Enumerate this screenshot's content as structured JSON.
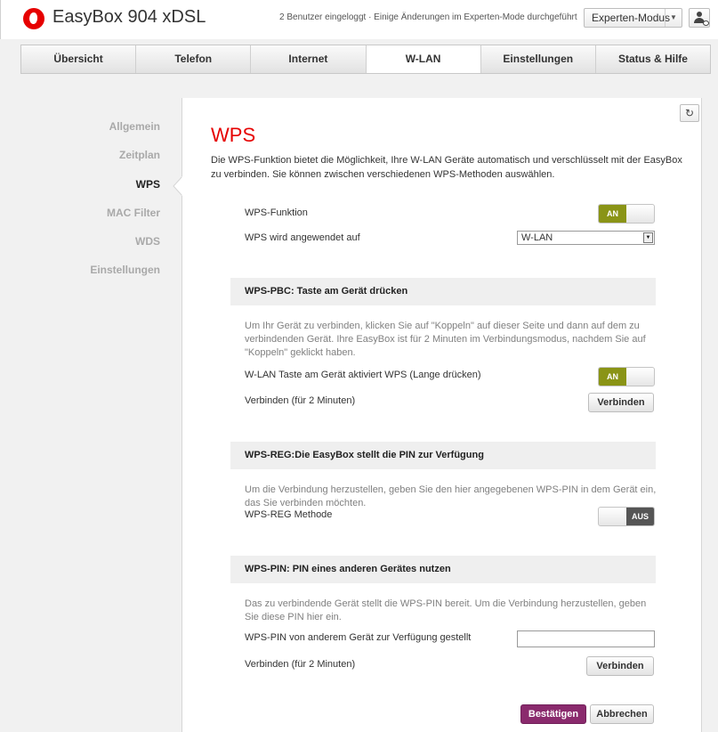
{
  "header": {
    "title": "EasyBox 904 xDSL",
    "session_info": "2 Benutzer eingeloggt · Einige Änderungen im Experten-Mode durchgeführt",
    "mode_select_value": "Experten-Modus",
    "logo_icon": "vodafone-logo",
    "user_icon": "user-icon"
  },
  "nav": {
    "tabs": [
      "Übersicht",
      "Telefon",
      "Internet",
      "W-LAN",
      "Einstellungen",
      "Status & Hilfe"
    ],
    "active": "W-LAN"
  },
  "sidebar": {
    "items": [
      "Allgemein",
      "Zeitplan",
      "WPS",
      "MAC Filter",
      "WDS",
      "Einstellungen"
    ],
    "active": "WPS"
  },
  "page": {
    "title": "WPS",
    "intro": "Die WPS-Funktion bietet die Möglichkeit, Ihre W-LAN Geräte automatisch und verschlüsselt mit der EasyBox zu verbinden. Sie können zwischen verschiedenen WPS-Methoden auswählen.",
    "refresh_icon": "refresh-icon"
  },
  "wps": {
    "function_label": "WPS-Funktion",
    "function_toggle": "AN",
    "applies_label": "WPS wird angewendet auf",
    "applies_value": "W-LAN"
  },
  "pbc": {
    "heading": "WPS-PBC: Taste am Gerät drücken",
    "desc": "Um Ihr Gerät zu verbinden, klicken Sie auf \"Koppeln\" auf dieser Seite und dann auf dem zu verbindenden Gerät. Ihre EasyBox ist für 2 Minuten im Verbindungsmodus, nachdem Sie auf \"Koppeln\" geklickt haben.",
    "button_label": "W-LAN Taste am Gerät aktiviert WPS (Lange drücken)",
    "button_toggle": "AN",
    "connect_label": "Verbinden (für 2 Minuten)",
    "connect_button": "Verbinden"
  },
  "reg": {
    "heading": "WPS-REG:Die EasyBox stellt die PIN zur Verfügung",
    "desc": "Um die Verbindung herzustellen, geben Sie den hier angegebenen WPS-PIN in dem Gerät ein, das Sie verbinden möchten.",
    "method_label": "WPS-REG Methode",
    "method_toggle": "AUS"
  },
  "pin": {
    "heading": "WPS-PIN: PIN eines anderen Gerätes nutzen",
    "desc": "Das zu verbindende Gerät stellt die WPS-PIN bereit. Um die Verbindung herzustellen, geben Sie diese PIN hier ein.",
    "pin_label": "WPS-PIN von anderem Gerät zur Verfügung gestellt",
    "pin_value": "",
    "connect_label": "Verbinden (für 2 Minuten)",
    "connect_button": "Verbinden"
  },
  "actions": {
    "confirm": "Bestätigen",
    "cancel": "Abbrechen"
  },
  "colors": {
    "brand_red": "#e60000",
    "toggle_on": "#8a9416",
    "toggle_off": "#555555",
    "primary_button": "#8a2a6d"
  }
}
